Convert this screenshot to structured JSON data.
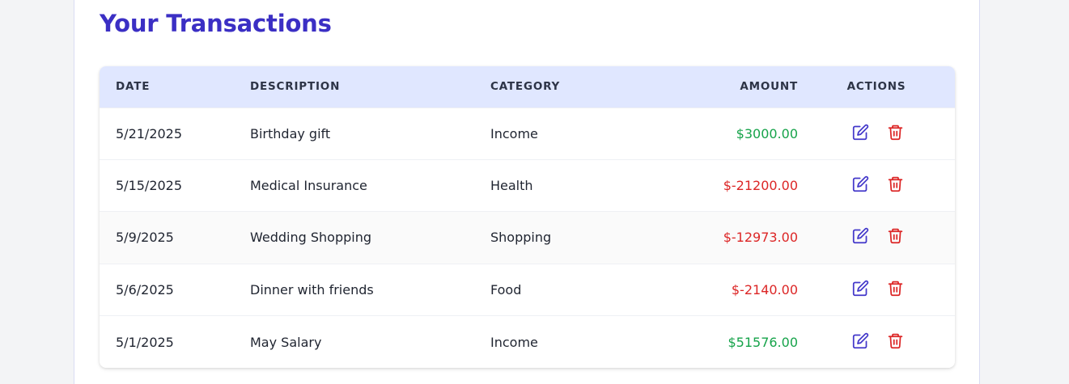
{
  "page": {
    "title": "Your Transactions"
  },
  "colors": {
    "title": "#3b2fc4",
    "header_bg": "#e0e7ff",
    "positive": "#16a34a",
    "negative": "#dc2626",
    "edit_icon": "#4338ca",
    "delete_icon": "#dc2626"
  },
  "table": {
    "headers": {
      "date": "DATE",
      "description": "DESCRIPTION",
      "category": "CATEGORY",
      "amount": "AMOUNT",
      "actions": "ACTIONS"
    },
    "rows": [
      {
        "date": "5/21/2025",
        "description": "Birthday gift",
        "category": "Income",
        "amount": "$3000.00",
        "sign": "positive"
      },
      {
        "date": "5/15/2025",
        "description": "Medical Insurance",
        "category": "Health",
        "amount": "$-21200.00",
        "sign": "negative"
      },
      {
        "date": "5/9/2025",
        "description": "Wedding Shopping",
        "category": "Shopping",
        "amount": "$-12973.00",
        "sign": "negative"
      },
      {
        "date": "5/6/2025",
        "description": "Dinner with friends",
        "category": "Food",
        "amount": "$-2140.00",
        "sign": "negative"
      },
      {
        "date": "5/1/2025",
        "description": "May Salary",
        "category": "Income",
        "amount": "$51576.00",
        "sign": "positive"
      }
    ],
    "row_icons": {
      "edit": "edit-icon",
      "delete": "trash-icon"
    }
  }
}
